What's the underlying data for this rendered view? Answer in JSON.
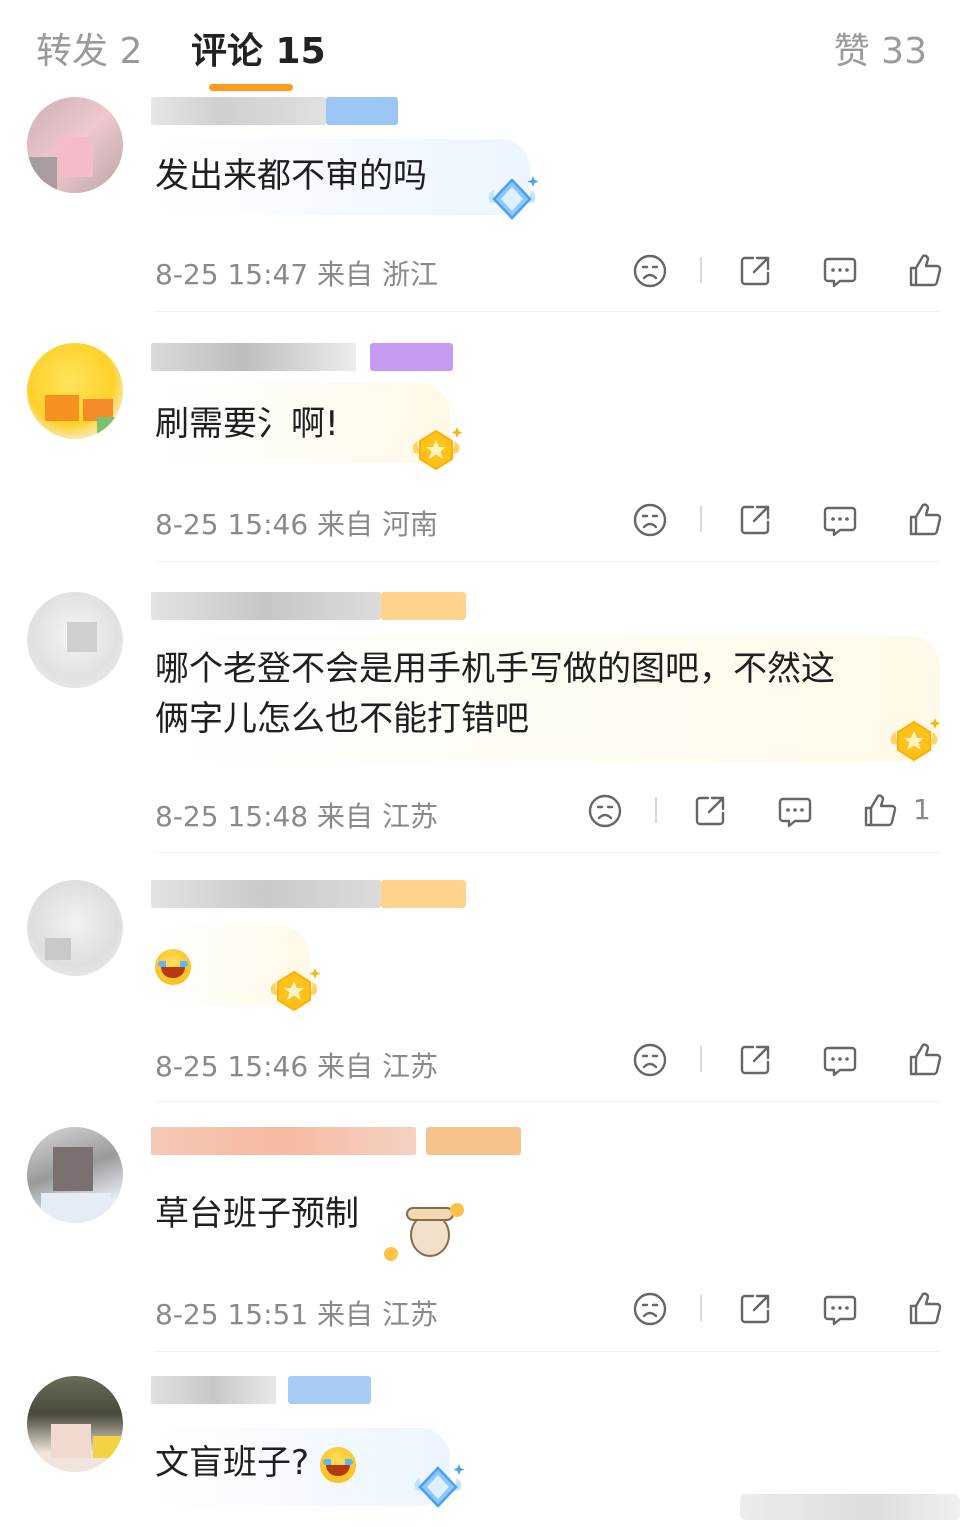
{
  "tabs": [
    {
      "label": "转发 2",
      "active": false
    },
    {
      "label": "评论 15",
      "active": true
    },
    {
      "label": "赞 33",
      "active": false
    }
  ],
  "accent": "#ff9a1f",
  "comments": [
    {
      "text": "发出来都不审的吗",
      "time": "8-25 15:47",
      "source": "来自 浙江",
      "likes": "",
      "badge": "blue-diamond-medal"
    },
    {
      "text": "刷需要氵啊!",
      "time": "8-25 15:46",
      "source": "来自 河南",
      "likes": "",
      "badge": "gold-medal"
    },
    {
      "text_line1": "哪个老登不会是用手机手写做的图吧，不然这",
      "text_line2": "俩字儿怎么也不能打错吧",
      "time": "8-25 15:48",
      "source": "来自 江苏",
      "likes": "1",
      "badge": "gold-medal"
    },
    {
      "text": "",
      "emoji": "laughing-tears-emoji",
      "time": "8-25 15:46",
      "source": "来自 江苏",
      "likes": "",
      "badge": "gold-medal"
    },
    {
      "text": "草台班子预制",
      "time": "8-25 15:51",
      "source": "来自 江苏",
      "likes": "",
      "badge": "bear-sticker"
    },
    {
      "text": "文盲班子?",
      "emoji": "laughing-tears-emoji",
      "time": "",
      "source": "",
      "likes": "",
      "badge": "blue-diamond-medal"
    }
  ],
  "icons": [
    "sad-face-icon",
    "share-icon",
    "comment-icon",
    "thumbs-up-icon"
  ]
}
